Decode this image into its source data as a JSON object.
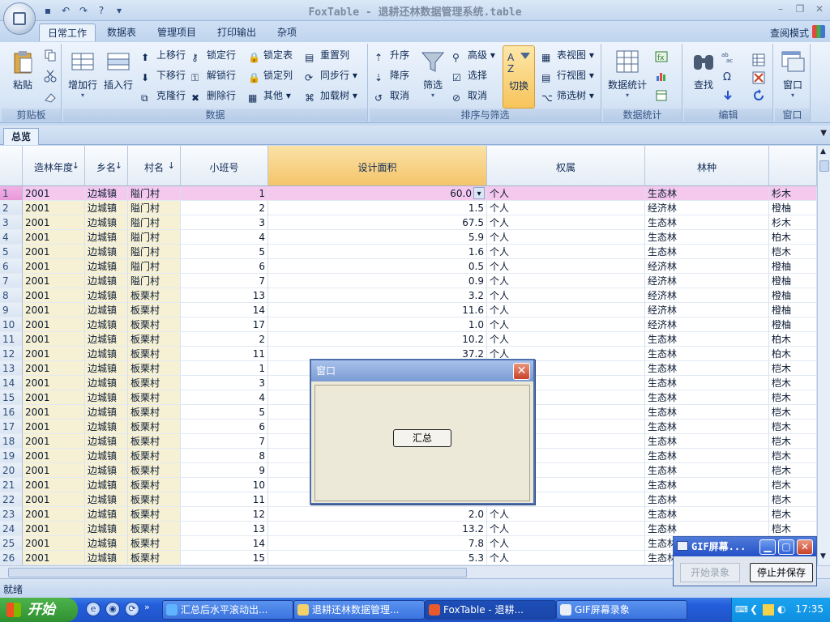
{
  "window": {
    "title": "FoxTable - 退耕还林数据管理系统.table",
    "view_mode": "查阅模式"
  },
  "ribbon_tabs": [
    "日常工作",
    "数据表",
    "管理项目",
    "打印输出",
    "杂项"
  ],
  "ribbon": {
    "clipboard": {
      "label": "剪贴板",
      "paste": "粘贴"
    },
    "data": {
      "label": "数据",
      "add_row": "增加行",
      "insert_row": "插入行",
      "move_up": "上移行",
      "move_down": "下移行",
      "clone_row": "克隆行",
      "lock_row": "锁定行",
      "unlock_row": "解锁行",
      "delete_row": "删除行",
      "lock_table": "锁定表",
      "lock_column": "锁定列",
      "other": "其他",
      "reset_column": "重置列",
      "sync_row": "同步行",
      "load_tree": "加载树"
    },
    "sort_filter": {
      "label": "排序与筛选",
      "asc": "升序",
      "desc": "降序",
      "cancel_sort": "取消",
      "filter": "筛选",
      "advanced": "高级",
      "select": "选择",
      "cancel_filter": "取消",
      "toggle": "切换",
      "table_view": "表视图",
      "row_view": "行视图",
      "filter_tree": "筛选树"
    },
    "stats": {
      "label": "数据统计",
      "data_stats": "数据统计"
    },
    "edit": {
      "label": "编辑",
      "find": "查找"
    },
    "window": {
      "label": "窗口",
      "window_btn": "窗口"
    }
  },
  "doc_tab": "总览",
  "grid": {
    "columns": [
      "造林年度",
      "乡名",
      "村名",
      "小班号",
      "设计面积",
      "权属",
      "林种"
    ],
    "extra_col_visible": true,
    "rows": [
      {
        "n": "1",
        "year": "2001",
        "town": "边城镇",
        "village": "隘门村",
        "plot": "1",
        "area": "60.0",
        "owner": "个人",
        "type": "生态林",
        "tree": "杉木"
      },
      {
        "n": "2",
        "year": "2001",
        "town": "边城镇",
        "village": "隘门村",
        "plot": "2",
        "area": "1.5",
        "owner": "个人",
        "type": "经济林",
        "tree": "橙柚"
      },
      {
        "n": "3",
        "year": "2001",
        "town": "边城镇",
        "village": "隘门村",
        "plot": "3",
        "area": "67.5",
        "owner": "个人",
        "type": "生态林",
        "tree": "杉木"
      },
      {
        "n": "4",
        "year": "2001",
        "town": "边城镇",
        "village": "隘门村",
        "plot": "4",
        "area": "5.9",
        "owner": "个人",
        "type": "生态林",
        "tree": "柏木"
      },
      {
        "n": "5",
        "year": "2001",
        "town": "边城镇",
        "village": "隘门村",
        "plot": "5",
        "area": "1.6",
        "owner": "个人",
        "type": "生态林",
        "tree": "桤木"
      },
      {
        "n": "6",
        "year": "2001",
        "town": "边城镇",
        "village": "隘门村",
        "plot": "6",
        "area": "0.5",
        "owner": "个人",
        "type": "经济林",
        "tree": "橙柚"
      },
      {
        "n": "7",
        "year": "2001",
        "town": "边城镇",
        "village": "隘门村",
        "plot": "7",
        "area": "0.9",
        "owner": "个人",
        "type": "经济林",
        "tree": "橙柚"
      },
      {
        "n": "8",
        "year": "2001",
        "town": "边城镇",
        "village": "板栗村",
        "plot": "13",
        "area": "3.2",
        "owner": "个人",
        "type": "经济林",
        "tree": "橙柚"
      },
      {
        "n": "9",
        "year": "2001",
        "town": "边城镇",
        "village": "板栗村",
        "plot": "14",
        "area": "11.6",
        "owner": "个人",
        "type": "经济林",
        "tree": "橙柚"
      },
      {
        "n": "10",
        "year": "2001",
        "town": "边城镇",
        "village": "板栗村",
        "plot": "17",
        "area": "1.0",
        "owner": "个人",
        "type": "经济林",
        "tree": "橙柚"
      },
      {
        "n": "11",
        "year": "2001",
        "town": "边城镇",
        "village": "板栗村",
        "plot": "2",
        "area": "10.2",
        "owner": "个人",
        "type": "生态林",
        "tree": "柏木"
      },
      {
        "n": "12",
        "year": "2001",
        "town": "边城镇",
        "village": "板栗村",
        "plot": "11",
        "area": "37.2",
        "owner": "个人",
        "type": "生态林",
        "tree": "柏木"
      },
      {
        "n": "13",
        "year": "2001",
        "town": "边城镇",
        "village": "板栗村",
        "plot": "1",
        "area": "",
        "owner": "",
        "type": "生态林",
        "tree": "桤木"
      },
      {
        "n": "14",
        "year": "2001",
        "town": "边城镇",
        "village": "板栗村",
        "plot": "3",
        "area": "",
        "owner": "",
        "type": "生态林",
        "tree": "桤木"
      },
      {
        "n": "15",
        "year": "2001",
        "town": "边城镇",
        "village": "板栗村",
        "plot": "4",
        "area": "",
        "owner": "",
        "type": "生态林",
        "tree": "桤木"
      },
      {
        "n": "16",
        "year": "2001",
        "town": "边城镇",
        "village": "板栗村",
        "plot": "5",
        "area": "",
        "owner": "",
        "type": "生态林",
        "tree": "桤木"
      },
      {
        "n": "17",
        "year": "2001",
        "town": "边城镇",
        "village": "板栗村",
        "plot": "6",
        "area": "",
        "owner": "",
        "type": "生态林",
        "tree": "桤木"
      },
      {
        "n": "18",
        "year": "2001",
        "town": "边城镇",
        "village": "板栗村",
        "plot": "7",
        "area": "",
        "owner": "",
        "type": "生态林",
        "tree": "桤木"
      },
      {
        "n": "19",
        "year": "2001",
        "town": "边城镇",
        "village": "板栗村",
        "plot": "8",
        "area": "",
        "owner": "",
        "type": "生态林",
        "tree": "桤木"
      },
      {
        "n": "20",
        "year": "2001",
        "town": "边城镇",
        "village": "板栗村",
        "plot": "9",
        "area": "",
        "owner": "",
        "type": "生态林",
        "tree": "桤木"
      },
      {
        "n": "21",
        "year": "2001",
        "town": "边城镇",
        "village": "板栗村",
        "plot": "10",
        "area": "",
        "owner": "",
        "type": "生态林",
        "tree": "桤木"
      },
      {
        "n": "22",
        "year": "2001",
        "town": "边城镇",
        "village": "板栗村",
        "plot": "11",
        "area": "",
        "owner": "",
        "type": "生态林",
        "tree": "桤木"
      },
      {
        "n": "23",
        "year": "2001",
        "town": "边城镇",
        "village": "板栗村",
        "plot": "12",
        "area": "2.0",
        "owner": "个人",
        "type": "生态林",
        "tree": "桤木"
      },
      {
        "n": "24",
        "year": "2001",
        "town": "边城镇",
        "village": "板栗村",
        "plot": "13",
        "area": "13.2",
        "owner": "个人",
        "type": "生态林",
        "tree": "桤木"
      },
      {
        "n": "25",
        "year": "2001",
        "town": "边城镇",
        "village": "板栗村",
        "plot": "14",
        "area": "7.8",
        "owner": "个人",
        "type": "生态林",
        "tree": "桤木"
      },
      {
        "n": "26",
        "year": "2001",
        "town": "边城镇",
        "village": "板栗村",
        "plot": "15",
        "area": "5.3",
        "owner": "个人",
        "type": "生态林",
        "tree": ""
      }
    ]
  },
  "status": "就绪",
  "dialog": {
    "title": "窗口",
    "button": "汇总"
  },
  "gif_recorder": {
    "title": "GIF屏幕...",
    "start": "开始录象",
    "stop": "停止并保存"
  },
  "taskbar": {
    "start": "开始",
    "tasks": [
      "汇总后水平滚动出...",
      "退耕还林数据管理...",
      "FoxTable - 退耕...",
      "GIF屏幕录象"
    ],
    "clock": "17:35"
  }
}
